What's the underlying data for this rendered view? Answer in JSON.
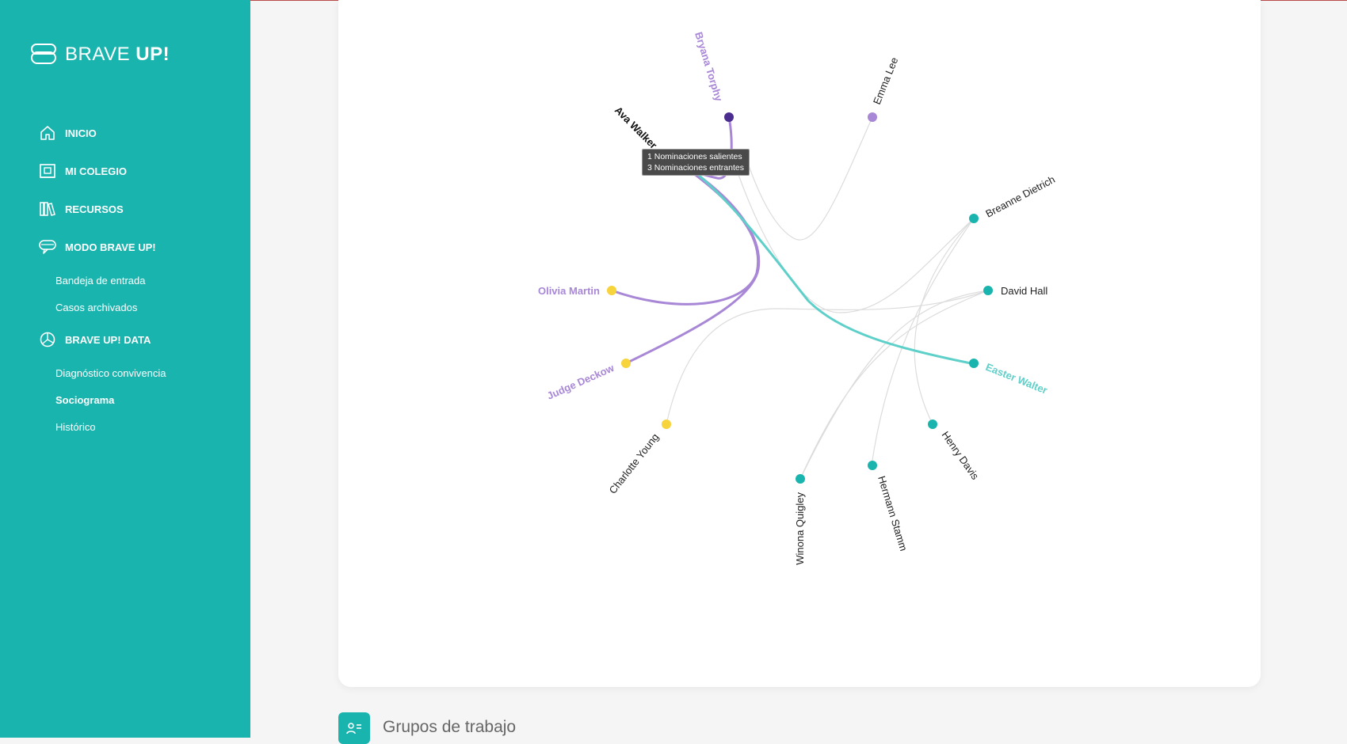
{
  "app": {
    "brand_light": "BRAVE",
    "brand_bold": "UP!"
  },
  "colors": {
    "sidebar": "#1ab4ae",
    "purple": "#a887d6",
    "dark_purple": "#4b2d8f",
    "yellow": "#f7d33c",
    "teal": "#1ab4ae"
  },
  "sidebar": {
    "items": [
      {
        "label": "INICIO",
        "icon": "home-icon"
      },
      {
        "label": "MI COLEGIO",
        "icon": "school-icon"
      },
      {
        "label": "RECURSOS",
        "icon": "books-icon"
      },
      {
        "label": "MODO BRAVE UP!",
        "icon": "chat-icon"
      },
      {
        "label": "BRAVE UP! DATA",
        "icon": "pie-chart-icon"
      }
    ],
    "modo_subitems": [
      "Bandeja de entrada",
      "Casos archivados"
    ],
    "data_subitems": [
      "Diagnóstico convivencia",
      "Sociograma",
      "Histórico"
    ],
    "active_subitem": "Sociograma"
  },
  "sociogram": {
    "nodes": [
      {
        "name": "Bryana Torphy",
        "color": "#4b2d8f",
        "label_color": "#a887d6"
      },
      {
        "name": "Emma Lee",
        "color": "#a887d6",
        "label_color": "#222222"
      },
      {
        "name": "Breanne Dietrich",
        "color": "#1ab4ae",
        "label_color": "#222222"
      },
      {
        "name": "David Hall",
        "color": "#1ab4ae",
        "label_color": "#222222"
      },
      {
        "name": "Easter Walter",
        "color": "#1ab4ae",
        "label_color": "#5ed0c9"
      },
      {
        "name": "Henry Davis",
        "color": "#1ab4ae",
        "label_color": "#222222"
      },
      {
        "name": "Hermann Stamm",
        "color": "#1ab4ae",
        "label_color": "#222222"
      },
      {
        "name": "Winona Quigley",
        "color": "#1ab4ae",
        "label_color": "#222222"
      },
      {
        "name": "Charlotte Young",
        "color": "#f7d33c",
        "label_color": "#222222"
      },
      {
        "name": "Judge Deckow",
        "color": "#f7d33c",
        "label_color": "#a887d6"
      },
      {
        "name": "Olivia Martin",
        "color": "#f7d33c",
        "label_color": "#a887d6"
      },
      {
        "name": "Ava Walker",
        "color": "#4b2d8f",
        "label_color": "#111111"
      }
    ],
    "hovered": "Ava Walker",
    "tooltip": {
      "line1": "1 Nominaciones salientes",
      "line2": "3 Nominaciones entrantes"
    }
  },
  "section": {
    "title": "Grupos de trabajo",
    "icon": "group-list-icon"
  }
}
